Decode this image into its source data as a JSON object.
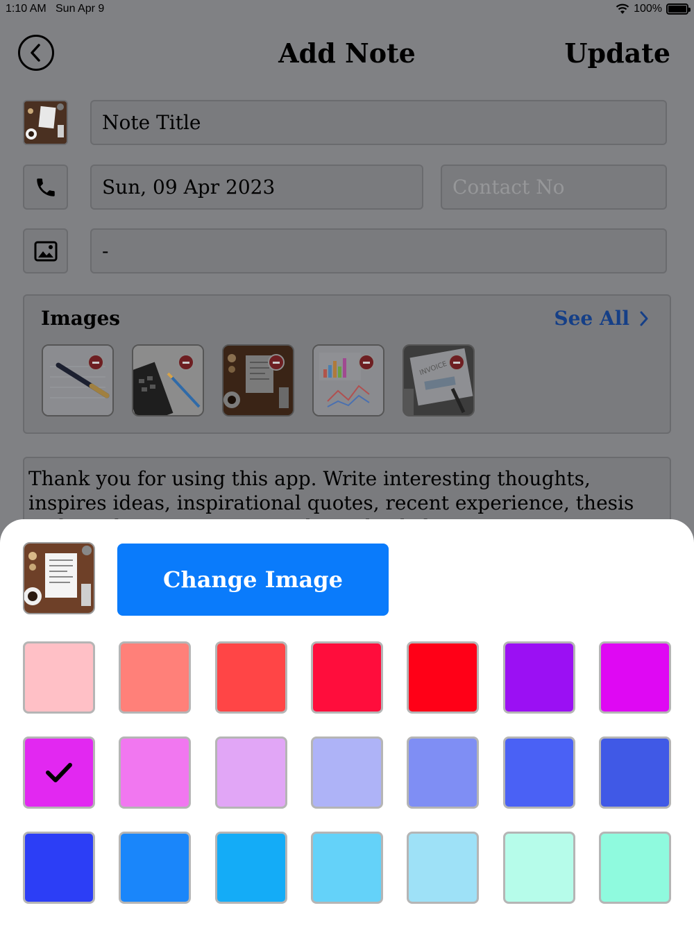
{
  "status_bar": {
    "time": "1:10 AM",
    "date": "Sun Apr 9",
    "battery": "100%"
  },
  "header": {
    "title": "Add Note",
    "update_label": "Update"
  },
  "form": {
    "note_title_placeholder": "Note Title",
    "date_value": "Sun, 09 Apr 2023",
    "contact_placeholder": "Contact No",
    "image_field_value": "-"
  },
  "images": {
    "title": "Images",
    "see_all_label": "See All",
    "thumbnails": [
      "notebook-pen",
      "calculator-papers",
      "desk-document",
      "colorful-charts",
      "invoice-paper"
    ]
  },
  "note": {
    "body": "Thank you for using this app. Write interesting thoughts, inspires ideas, inspirational quotes, recent experience, thesis and anything at anytime with single click"
  },
  "sheet": {
    "change_image_label": "Change Image",
    "selected_color_index": 7,
    "colors": [
      "#ffc0c6",
      "#ff8079",
      "#ff4546",
      "#ff0d3c",
      "#ff0017",
      "#9b10f3",
      "#df08f3",
      "#e228f1",
      "#f177f0",
      "#e1a6f6",
      "#aeb3f7",
      "#7f8ef4",
      "#4a61f5",
      "#4059e6",
      "#2c3ef6",
      "#1a86fa",
      "#14acf7",
      "#64d2f9",
      "#9ee1f7",
      "#b6fcea",
      "#8ffade"
    ]
  }
}
